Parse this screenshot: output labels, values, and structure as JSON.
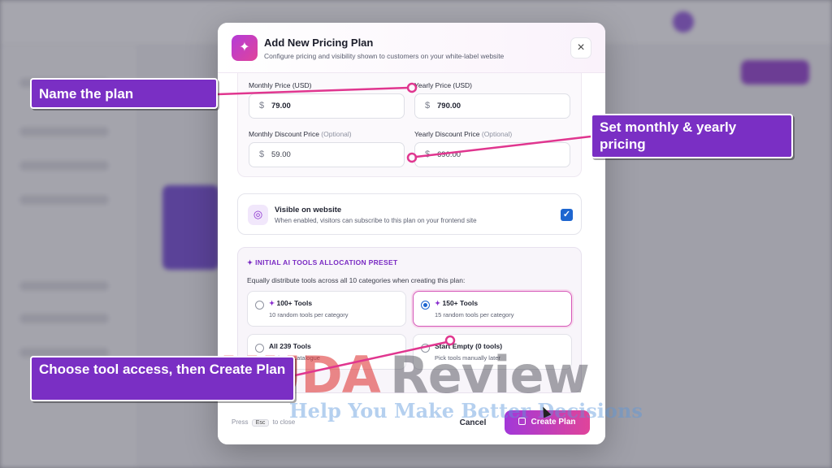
{
  "modal": {
    "title": "Add New Pricing Plan",
    "subtitle": "Configure pricing and visibility shown to customers on your white-label website",
    "close_symbol": "×",
    "header_icon": "sparkles-icon"
  },
  "pricing": {
    "monthly_price": {
      "label": "Monthly Price (USD)",
      "currency": "$",
      "value": "79.00"
    },
    "yearly_price": {
      "label": "Yearly Price (USD)",
      "currency": "$",
      "value": "790.00"
    },
    "monthly_discount": {
      "label": "Monthly Discount Price",
      "optional": "(Optional)",
      "currency": "$",
      "value": "59.00"
    },
    "yearly_discount": {
      "label": "Yearly Discount Price",
      "optional": "(Optional)",
      "currency": "$",
      "value": "690.00"
    }
  },
  "visibility": {
    "title": "Visible on website",
    "subtitle": "When enabled, visitors can subscribe to this plan on your frontend site",
    "checked": true,
    "check_symbol": "✓",
    "icon": "check-circle-icon"
  },
  "preset": {
    "title": "INITIAL AI TOOLS ALLOCATION PRESET",
    "description": "Equally distribute tools across all 10 categories when creating this plan:",
    "options": [
      {
        "title": "100+ Tools",
        "subtitle": "10 random tools per category",
        "selected": false,
        "icon": "sparkles-icon"
      },
      {
        "title": "150+ Tools",
        "subtitle": "15 random tools per category",
        "selected": true,
        "icon": "sparkles-icon"
      },
      {
        "title": "All 239 Tools",
        "subtitle": "Entire AI catalogue",
        "selected": false
      },
      {
        "title": "Start Empty (0 tools)",
        "subtitle": "Pick tools manually later",
        "selected": false
      }
    ]
  },
  "footer": {
    "hint_prefix": "Press",
    "hint_key": "Esc",
    "hint_suffix": "to close",
    "cancel_label": "Cancel",
    "create_label": "Create Plan"
  },
  "annotations": {
    "name_plan": "Name the plan",
    "set_pricing": "Set monthly & yearly pricing",
    "choose_tools": "Choose tool access, then Create Plan"
  },
  "watermark": {
    "part1": "HUDA",
    "part2": "Review",
    "tagline": "Help You Make Better Decisions"
  },
  "colors": {
    "accent_purple": "#7a2fc4",
    "arrow_pink": "#e0368f",
    "checkbox_blue": "#1e66d0"
  }
}
